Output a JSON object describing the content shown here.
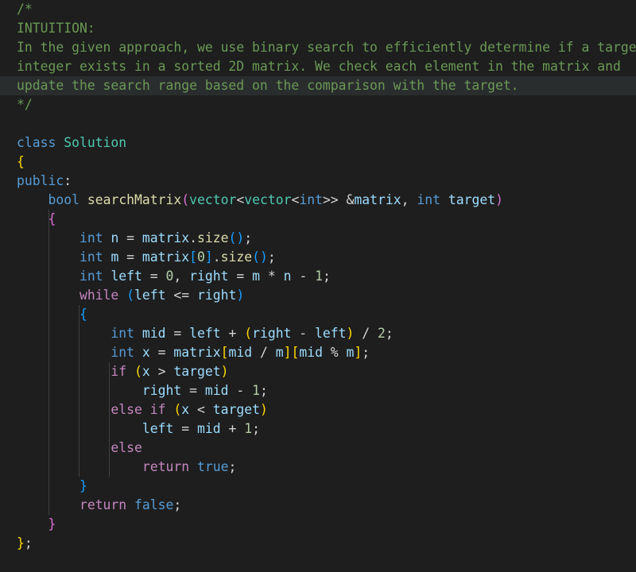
{
  "editor": {
    "lines": [
      {
        "tokens": [
          {
            "t": "/*",
            "c": "comment"
          }
        ]
      },
      {
        "tokens": [
          {
            "t": "INTUITION:",
            "c": "comment"
          }
        ]
      },
      {
        "tokens": [
          {
            "t": "In the given approach, we use binary search to efficiently determine if a target",
            "c": "comment"
          }
        ]
      },
      {
        "tokens": [
          {
            "t": "integer exists in a sorted 2D matrix. We check each element in the matrix and",
            "c": "comment"
          }
        ]
      },
      {
        "tokens": [
          {
            "t": "update the search range based on the comparison with the target.",
            "c": "comment"
          }
        ],
        "current": true
      },
      {
        "tokens": [
          {
            "t": "*/",
            "c": "comment"
          }
        ]
      },
      {
        "tokens": []
      },
      {
        "tokens": [
          {
            "t": "class",
            "c": "keyword"
          },
          {
            "t": " ",
            "c": "plain"
          },
          {
            "t": "Solution",
            "c": "type"
          }
        ]
      },
      {
        "tokens": [
          {
            "t": "{",
            "c": "b1"
          }
        ]
      },
      {
        "tokens": [
          {
            "t": "public",
            "c": "keyword"
          },
          {
            "t": ":",
            "c": "plain"
          }
        ]
      },
      {
        "tokens": [
          {
            "t": "    ",
            "c": "plain"
          },
          {
            "t": "bool",
            "c": "keyword"
          },
          {
            "t": " ",
            "c": "plain"
          },
          {
            "t": "searchMatrix",
            "c": "func"
          },
          {
            "t": "(",
            "c": "b2"
          },
          {
            "t": "vector",
            "c": "type"
          },
          {
            "t": "<",
            "c": "plain"
          },
          {
            "t": "vector",
            "c": "type"
          },
          {
            "t": "<",
            "c": "plain"
          },
          {
            "t": "int",
            "c": "keyword"
          },
          {
            "t": ">> &",
            "c": "plain"
          },
          {
            "t": "matrix",
            "c": "var"
          },
          {
            "t": ", ",
            "c": "plain"
          },
          {
            "t": "int",
            "c": "keyword"
          },
          {
            "t": " ",
            "c": "plain"
          },
          {
            "t": "target",
            "c": "var"
          },
          {
            "t": ")",
            "c": "b2"
          }
        ]
      },
      {
        "tokens": [
          {
            "t": "    ",
            "c": "plain"
          },
          {
            "t": "{",
            "c": "b2"
          }
        ]
      },
      {
        "tokens": [
          {
            "t": "        ",
            "c": "plain"
          },
          {
            "t": "int",
            "c": "keyword"
          },
          {
            "t": " ",
            "c": "plain"
          },
          {
            "t": "n",
            "c": "var"
          },
          {
            "t": " = ",
            "c": "plain"
          },
          {
            "t": "matrix",
            "c": "var"
          },
          {
            "t": ".",
            "c": "plain"
          },
          {
            "t": "size",
            "c": "func"
          },
          {
            "t": "()",
            "c": "b3"
          },
          {
            "t": ";",
            "c": "plain"
          }
        ]
      },
      {
        "tokens": [
          {
            "t": "        ",
            "c": "plain"
          },
          {
            "t": "int",
            "c": "keyword"
          },
          {
            "t": " ",
            "c": "plain"
          },
          {
            "t": "m",
            "c": "var"
          },
          {
            "t": " = ",
            "c": "plain"
          },
          {
            "t": "matrix",
            "c": "var"
          },
          {
            "t": "[",
            "c": "b3"
          },
          {
            "t": "0",
            "c": "num"
          },
          {
            "t": "]",
            "c": "b3"
          },
          {
            "t": ".",
            "c": "plain"
          },
          {
            "t": "size",
            "c": "func"
          },
          {
            "t": "()",
            "c": "b3"
          },
          {
            "t": ";",
            "c": "plain"
          }
        ]
      },
      {
        "tokens": [
          {
            "t": "        ",
            "c": "plain"
          },
          {
            "t": "int",
            "c": "keyword"
          },
          {
            "t": " ",
            "c": "plain"
          },
          {
            "t": "left",
            "c": "var"
          },
          {
            "t": " = ",
            "c": "plain"
          },
          {
            "t": "0",
            "c": "num"
          },
          {
            "t": ", ",
            "c": "plain"
          },
          {
            "t": "right",
            "c": "var"
          },
          {
            "t": " = ",
            "c": "plain"
          },
          {
            "t": "m",
            "c": "var"
          },
          {
            "t": " * ",
            "c": "plain"
          },
          {
            "t": "n",
            "c": "var"
          },
          {
            "t": " - ",
            "c": "plain"
          },
          {
            "t": "1",
            "c": "num"
          },
          {
            "t": ";",
            "c": "plain"
          }
        ]
      },
      {
        "tokens": [
          {
            "t": "        ",
            "c": "plain"
          },
          {
            "t": "while",
            "c": "control"
          },
          {
            "t": " ",
            "c": "plain"
          },
          {
            "t": "(",
            "c": "b3"
          },
          {
            "t": "left",
            "c": "var"
          },
          {
            "t": " <= ",
            "c": "plain"
          },
          {
            "t": "right",
            "c": "var"
          },
          {
            "t": ")",
            "c": "b3"
          }
        ]
      },
      {
        "tokens": [
          {
            "t": "        ",
            "c": "plain"
          },
          {
            "t": "{",
            "c": "b3"
          }
        ]
      },
      {
        "tokens": [
          {
            "t": "            ",
            "c": "plain"
          },
          {
            "t": "int",
            "c": "keyword"
          },
          {
            "t": " ",
            "c": "plain"
          },
          {
            "t": "mid",
            "c": "var"
          },
          {
            "t": " = ",
            "c": "plain"
          },
          {
            "t": "left",
            "c": "var"
          },
          {
            "t": " + ",
            "c": "plain"
          },
          {
            "t": "(",
            "c": "b1"
          },
          {
            "t": "right",
            "c": "var"
          },
          {
            "t": " - ",
            "c": "plain"
          },
          {
            "t": "left",
            "c": "var"
          },
          {
            "t": ")",
            "c": "b1"
          },
          {
            "t": " / ",
            "c": "plain"
          },
          {
            "t": "2",
            "c": "num"
          },
          {
            "t": ";",
            "c": "plain"
          }
        ]
      },
      {
        "tokens": [
          {
            "t": "            ",
            "c": "plain"
          },
          {
            "t": "int",
            "c": "keyword"
          },
          {
            "t": " ",
            "c": "plain"
          },
          {
            "t": "x",
            "c": "var"
          },
          {
            "t": " = ",
            "c": "plain"
          },
          {
            "t": "matrix",
            "c": "var"
          },
          {
            "t": "[",
            "c": "b1"
          },
          {
            "t": "mid",
            "c": "var"
          },
          {
            "t": " / ",
            "c": "plain"
          },
          {
            "t": "m",
            "c": "var"
          },
          {
            "t": "]",
            "c": "b1"
          },
          {
            "t": "[",
            "c": "b1"
          },
          {
            "t": "mid",
            "c": "var"
          },
          {
            "t": " % ",
            "c": "plain"
          },
          {
            "t": "m",
            "c": "var"
          },
          {
            "t": "]",
            "c": "b1"
          },
          {
            "t": ";",
            "c": "plain"
          }
        ]
      },
      {
        "tokens": [
          {
            "t": "            ",
            "c": "plain"
          },
          {
            "t": "if",
            "c": "control"
          },
          {
            "t": " ",
            "c": "plain"
          },
          {
            "t": "(",
            "c": "b1"
          },
          {
            "t": "x",
            "c": "var"
          },
          {
            "t": " > ",
            "c": "plain"
          },
          {
            "t": "target",
            "c": "var"
          },
          {
            "t": ")",
            "c": "b1"
          }
        ]
      },
      {
        "tokens": [
          {
            "t": "                ",
            "c": "plain"
          },
          {
            "t": "right",
            "c": "var"
          },
          {
            "t": " = ",
            "c": "plain"
          },
          {
            "t": "mid",
            "c": "var"
          },
          {
            "t": " - ",
            "c": "plain"
          },
          {
            "t": "1",
            "c": "num"
          },
          {
            "t": ";",
            "c": "plain"
          }
        ]
      },
      {
        "tokens": [
          {
            "t": "            ",
            "c": "plain"
          },
          {
            "t": "else",
            "c": "control"
          },
          {
            "t": " ",
            "c": "plain"
          },
          {
            "t": "if",
            "c": "control"
          },
          {
            "t": " ",
            "c": "plain"
          },
          {
            "t": "(",
            "c": "b1"
          },
          {
            "t": "x",
            "c": "var"
          },
          {
            "t": " < ",
            "c": "plain"
          },
          {
            "t": "target",
            "c": "var"
          },
          {
            "t": ")",
            "c": "b1"
          }
        ]
      },
      {
        "tokens": [
          {
            "t": "                ",
            "c": "plain"
          },
          {
            "t": "left",
            "c": "var"
          },
          {
            "t": " = ",
            "c": "plain"
          },
          {
            "t": "mid",
            "c": "var"
          },
          {
            "t": " + ",
            "c": "plain"
          },
          {
            "t": "1",
            "c": "num"
          },
          {
            "t": ";",
            "c": "plain"
          }
        ]
      },
      {
        "tokens": [
          {
            "t": "            ",
            "c": "plain"
          },
          {
            "t": "else",
            "c": "control"
          }
        ]
      },
      {
        "tokens": [
          {
            "t": "                ",
            "c": "plain"
          },
          {
            "t": "return",
            "c": "control"
          },
          {
            "t": " ",
            "c": "plain"
          },
          {
            "t": "true",
            "c": "keyword"
          },
          {
            "t": ";",
            "c": "plain"
          }
        ]
      },
      {
        "tokens": [
          {
            "t": "        ",
            "c": "plain"
          },
          {
            "t": "}",
            "c": "b3"
          }
        ]
      },
      {
        "tokens": [
          {
            "t": "        ",
            "c": "plain"
          },
          {
            "t": "return",
            "c": "control"
          },
          {
            "t": " ",
            "c": "plain"
          },
          {
            "t": "false",
            "c": "keyword"
          },
          {
            "t": ";",
            "c": "plain"
          }
        ]
      },
      {
        "tokens": [
          {
            "t": "    ",
            "c": "plain"
          },
          {
            "t": "}",
            "c": "b2"
          }
        ]
      },
      {
        "tokens": [
          {
            "t": "}",
            "c": "b1"
          },
          {
            "t": ";",
            "c": "plain"
          }
        ]
      }
    ]
  }
}
